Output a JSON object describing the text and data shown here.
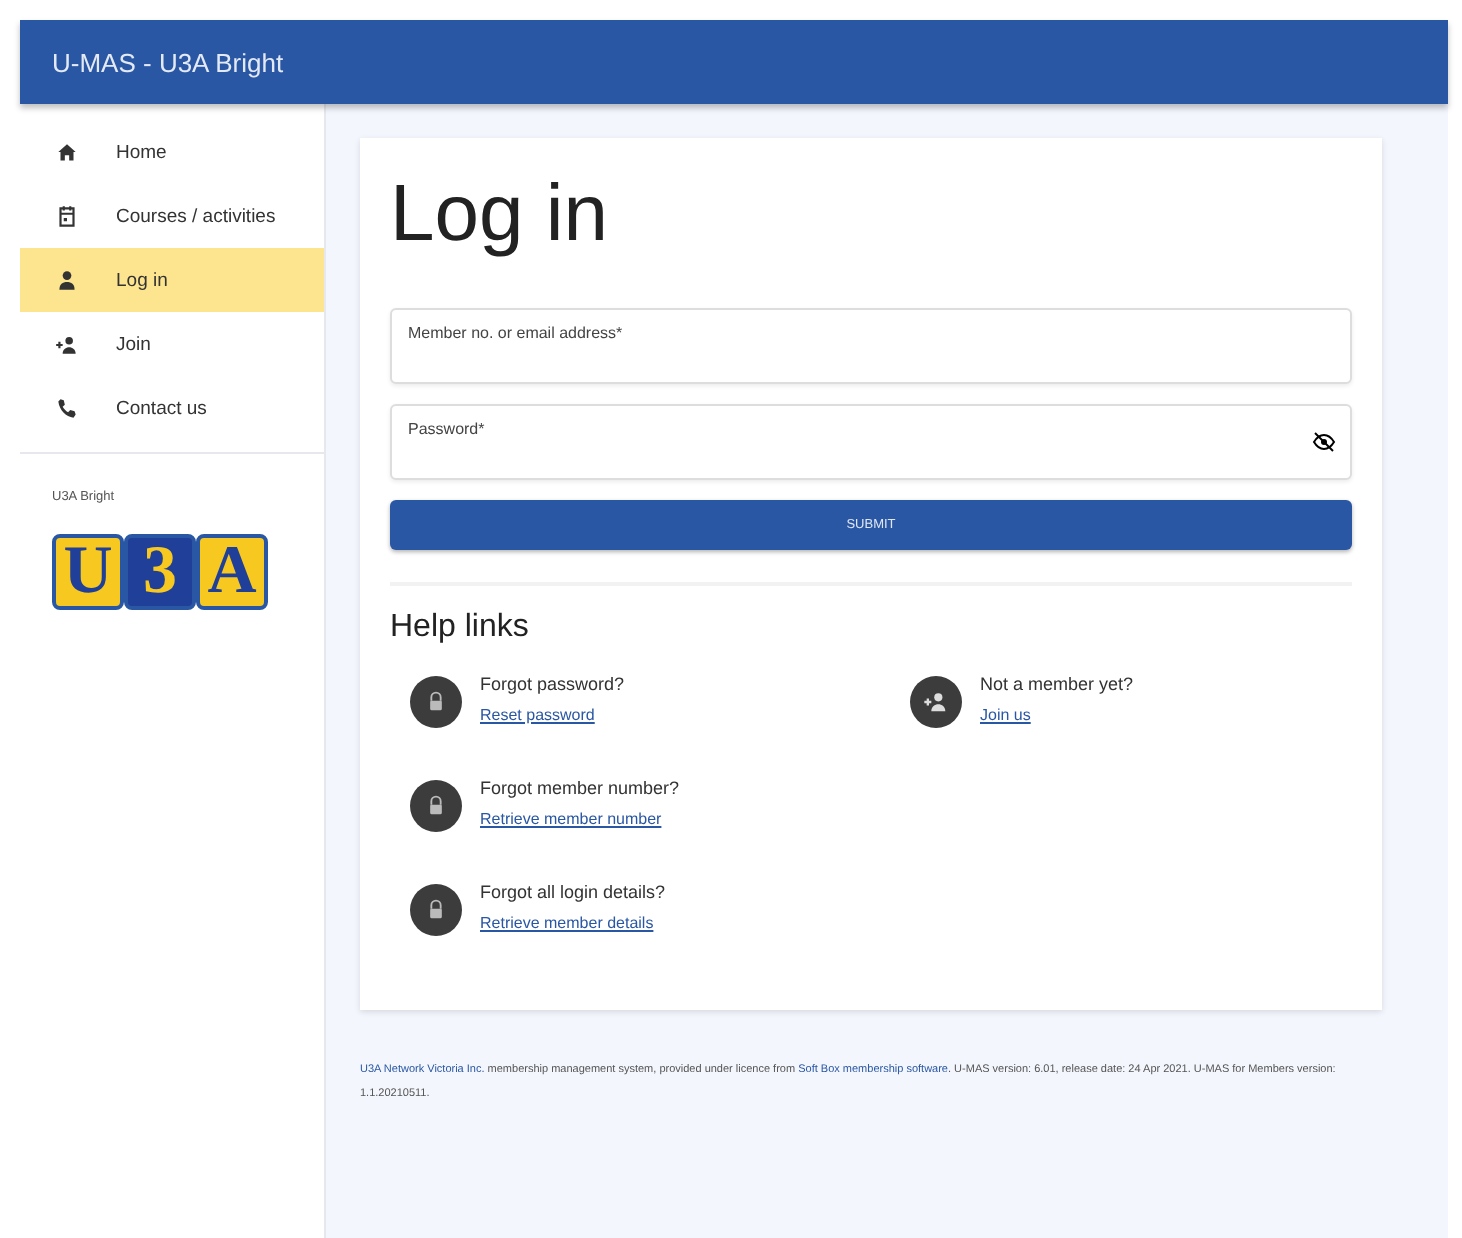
{
  "header": {
    "title": "U-MAS - U3A Bright"
  },
  "sidebar": {
    "items": [
      {
        "label": "Home",
        "selected": false
      },
      {
        "label": "Courses / activities",
        "selected": false
      },
      {
        "label": "Log in",
        "selected": true
      },
      {
        "label": "Join",
        "selected": false
      },
      {
        "label": "Contact us",
        "selected": false
      }
    ],
    "section_label": "U3A Bright",
    "logo_letters": [
      "U",
      "3",
      "A"
    ]
  },
  "login": {
    "title": "Log in",
    "fields": [
      {
        "placeholder": "Member no. or email address*",
        "kind": "text"
      },
      {
        "placeholder": "Password*",
        "kind": "password"
      }
    ],
    "submit": "SUBMIT"
  },
  "help": {
    "title": "Help links",
    "links": [
      {
        "question": "Forgot password?",
        "link": "Reset password",
        "kind": "recover"
      },
      {
        "question": "Not a member yet?",
        "link": "Join us",
        "kind": "join"
      },
      {
        "question": "Forgot member number?",
        "link": "Retrieve member number",
        "kind": "recover"
      },
      {
        "question": "Forgot all login details?",
        "link": "Retrieve member details",
        "kind": "recover"
      }
    ]
  },
  "footer": {
    "org_link": "U3A Network Victoria Inc.",
    "text_1": " membership management system, provided under licence from ",
    "vendor_link": "Soft Box membership software",
    "text_2": ". U-MAS version: 6.01, release date: 24 Apr 2021. U-MAS for Members version: 1.1.20210511."
  }
}
